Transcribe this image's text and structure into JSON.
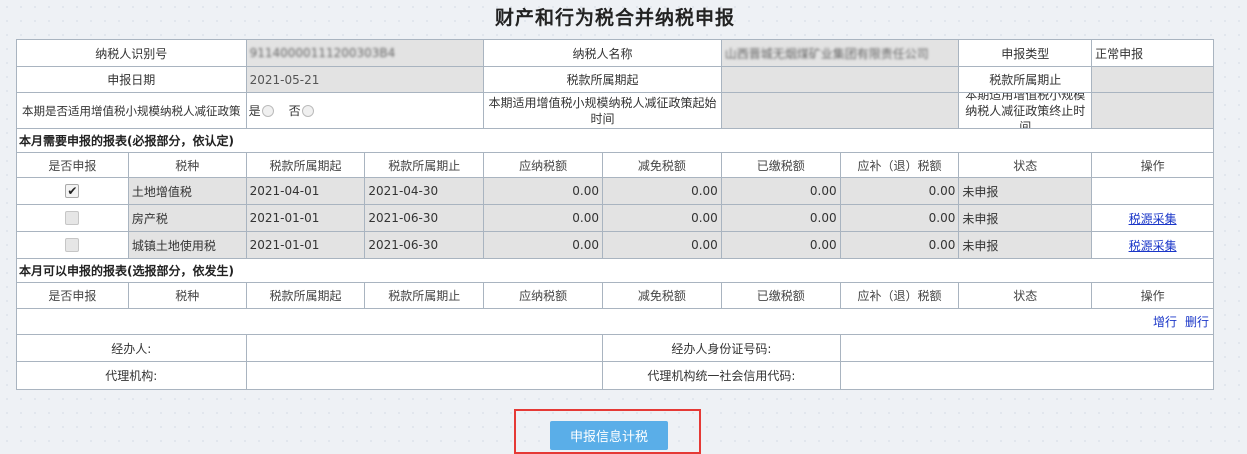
{
  "title": "财产和行为税合并纳税申报",
  "info": {
    "taxpayer_id_label": "纳税人识别号",
    "taxpayer_id_value": "91140000111200303B4",
    "taxpayer_name_label": "纳税人名称",
    "taxpayer_name_value": "山西晋城无烟煤矿业集团有限责任公司",
    "declare_type_label": "申报类型",
    "declare_type_value": "正常申报",
    "declare_date_label": "申报日期",
    "declare_date_value": "2021-05-21",
    "period_start_label": "税款所属期起",
    "period_start_value": "",
    "period_end_label": "税款所属期止",
    "period_end_value": "",
    "small_scale_label": "本期是否适用增值税小规模纳税人减征政策",
    "yes_label": "是",
    "no_label": "否",
    "policy_start_label": "本期适用增值税小规模纳税人减征政策起始时间",
    "policy_start_value": "",
    "policy_end_label": "本期适用增值税小规模纳税人减征政策终止时间",
    "policy_end_value": ""
  },
  "required_section": {
    "title": "本月需要申报的报表(必报部分，依认定)",
    "headers": [
      "是否申报",
      "税种",
      "税款所属期起",
      "税款所属期止",
      "应纳税额",
      "减免税额",
      "已缴税额",
      "应补（退）税额",
      "状态",
      "操作"
    ],
    "rows": [
      {
        "checked": true,
        "tax": "土地增值税",
        "start": "2021-04-01",
        "end": "2021-04-30",
        "payable": "0.00",
        "relief": "0.00",
        "paid": "0.00",
        "due": "0.00",
        "status": "未申报",
        "action": ""
      },
      {
        "checked": false,
        "tax": "房产税",
        "start": "2021-01-01",
        "end": "2021-06-30",
        "payable": "0.00",
        "relief": "0.00",
        "paid": "0.00",
        "due": "0.00",
        "status": "未申报",
        "action": "税源采集"
      },
      {
        "checked": false,
        "tax": "城镇土地使用税",
        "start": "2021-01-01",
        "end": "2021-06-30",
        "payable": "0.00",
        "relief": "0.00",
        "paid": "0.00",
        "due": "0.00",
        "status": "未申报",
        "action": "税源采集"
      }
    ]
  },
  "optional_section": {
    "title": "本月可以申报的报表(选报部分，依发生)",
    "headers": [
      "是否申报",
      "税种",
      "税款所属期起",
      "税款所属期止",
      "应纳税额",
      "减免税额",
      "已缴税额",
      "应补（退）税额",
      "状态",
      "操作"
    ],
    "add_row": "增行",
    "delete_row": "删行"
  },
  "footer": {
    "handler_label": "经办人:",
    "handler_value": "",
    "handler_id_label": "经办人身份证号码:",
    "handler_id_value": "",
    "agency_label": "代理机构:",
    "agency_value": "",
    "agency_code_label": "代理机构统一社会信用代码:",
    "agency_code_value": ""
  },
  "submit_label": "申报信息计税"
}
